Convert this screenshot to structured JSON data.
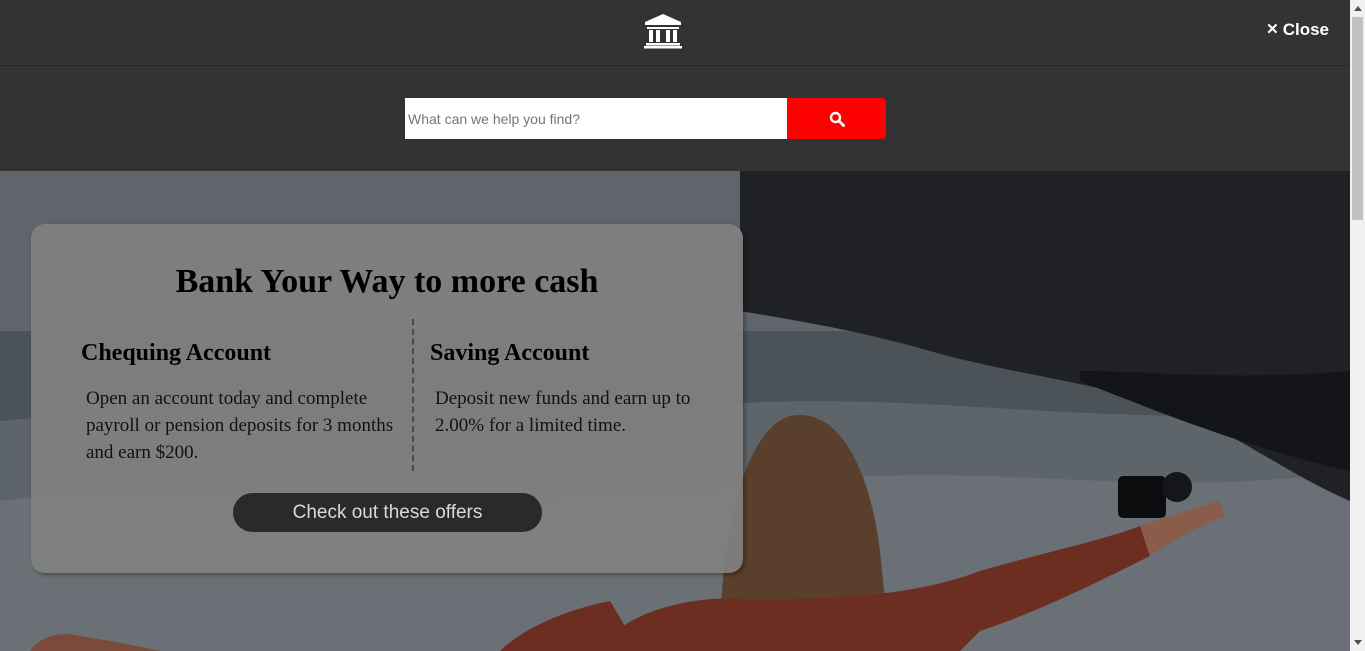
{
  "header": {
    "logo_icon": "bank-icon",
    "close_label": "Close",
    "close_icon": "close-icon"
  },
  "search": {
    "placeholder": "What can we help you find?",
    "value": "",
    "button_icon": "search-icon",
    "button_color": "#ff0000"
  },
  "promo": {
    "title": "Bank Your Way to more cash",
    "chequing": {
      "heading": "Chequing Account",
      "text": "Open an account today and complete payroll or pension deposits for 3 months and earn $200."
    },
    "saving": {
      "heading": "Saving Account",
      "text": "Deposit new funds and earn up to 2.00% for a limited time."
    },
    "cta_label": "Check out these offers"
  },
  "hero": {
    "image": "hero-photo-person-with-camera-by-ocean"
  },
  "colors": {
    "header_bg": "#333333",
    "accent": "#ff0000",
    "card_bg": "#807f80",
    "cta_bg": "#2b2a2b"
  }
}
